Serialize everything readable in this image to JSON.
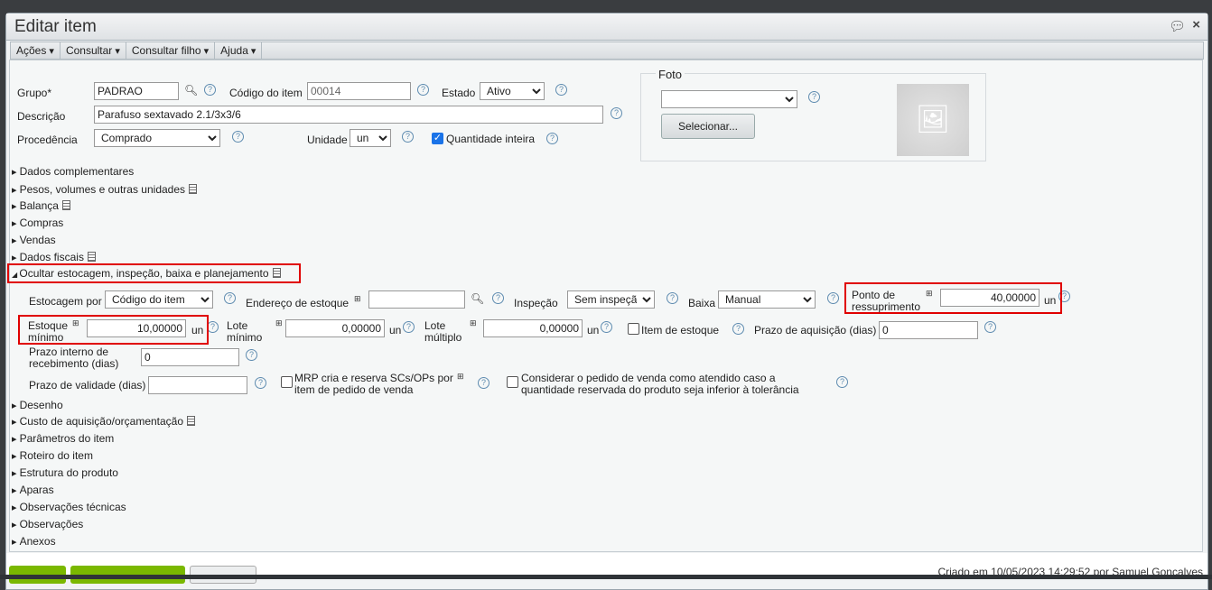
{
  "window": {
    "title": "Editar item"
  },
  "menu": [
    "Ações",
    "Consultar",
    "Consultar filho",
    "Ajuda"
  ],
  "form": {
    "grupo_label": "Grupo*",
    "grupo_value": "PADRAO",
    "codigo_label": "Código do item",
    "codigo_value": "00014",
    "estado_label": "Estado",
    "estado_value": "Ativo",
    "descricao_label": "Descrição",
    "descricao_value": "Parafuso sextavado 2.1/3x3/6",
    "procedencia_label": "Procedência",
    "procedencia_value": "Comprado",
    "unidade_label": "Unidade",
    "unidade_value": "un",
    "qtd_inteira_label": "Quantidade inteira"
  },
  "foto": {
    "legend": "Foto",
    "select_value": "",
    "button": "Selecionar..."
  },
  "sections_top": [
    {
      "label": "Dados complementares"
    },
    {
      "label": "Pesos, volumes e outras unidades"
    },
    {
      "label": "Balança"
    },
    {
      "label": "Compras"
    },
    {
      "label": "Vendas"
    },
    {
      "label": "Dados fiscais"
    }
  ],
  "open_section": {
    "label": "Ocultar estocagem, inspeção, baixa e planejamento"
  },
  "estoque": {
    "estocagem_label": "Estocagem por",
    "estocagem_value": "Código do item",
    "endereco_label": "Endereço de estoque",
    "endereco_value": "",
    "inspecao_label": "Inspeção",
    "inspecao_value": "Sem inspeção",
    "baixa_label": "Baixa",
    "baixa_value": "Manual",
    "ponto_label1": "Ponto de",
    "ponto_label2": "ressuprimento",
    "ponto_value": "40,00000",
    "estmin_label1": "Estoque",
    "estmin_label2": "mínimo",
    "estmin_value": "10,00000",
    "lotemin_label1": "Lote",
    "lotemin_label2": "mínimo",
    "lotemin_value": "0,00000",
    "lotemult_label1": "Lote",
    "lotemult_label2": "múltiplo",
    "lotemult_value": "0,00000",
    "unit": "un",
    "item_estoque_label": "Item de estoque",
    "prazo_aq_label": "Prazo de aquisição (dias)",
    "prazo_aq_value": "0",
    "prazo_int_label1": "Prazo interno de",
    "prazo_int_label2": "recebimento (dias)",
    "prazo_int_value": "0",
    "prazo_val_label": "Prazo de validade (dias)",
    "prazo_val_value": "",
    "mrp_label1": "MRP cria e reserva SCs/OPs por",
    "mrp_label2": "item de pedido de venda",
    "cons_label1": "Considerar o pedido de venda como atendido caso a",
    "cons_label2": "quantidade reservada do produto seja inferior à tolerância"
  },
  "sections_bottom": [
    {
      "label": "Desenho"
    },
    {
      "label": "Custo de aquisição/orçamentação"
    },
    {
      "label": "Parâmetros do item"
    },
    {
      "label": "Roteiro do item"
    },
    {
      "label": "Estrutura do produto"
    },
    {
      "label": "Aparas"
    },
    {
      "label": "Observações técnicas"
    },
    {
      "label": "Observações"
    },
    {
      "label": "Anexos"
    }
  ],
  "footer": {
    "created": "Criado em 10/05/2023 14:29:52 por Samuel Gonçalves"
  },
  "colors": {
    "highlight": "#e00000",
    "primary_button": "#7ab800"
  }
}
